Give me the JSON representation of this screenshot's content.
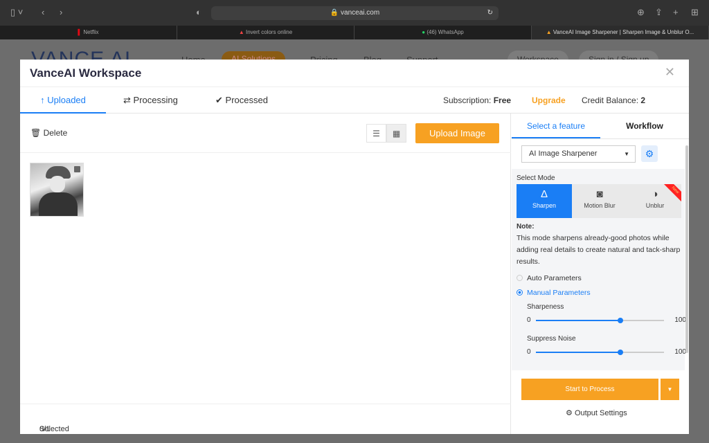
{
  "browser": {
    "url": "vanceai.com",
    "tabs": [
      {
        "label": "Netflix"
      },
      {
        "label": "Invert colors online"
      },
      {
        "label": "(46) WhatsApp"
      },
      {
        "label": "VanceAI Image Sharpener | Sharpen Image & Unblur O..."
      }
    ]
  },
  "site": {
    "logo": "VANCE AI",
    "nav": [
      "Home",
      "AI Solutions",
      "Pricing",
      "Blog",
      "Support"
    ],
    "workspace": "Workspace",
    "signin": "Sign in / Sign up"
  },
  "modal": {
    "title": "VanceAI Workspace",
    "tabs": [
      {
        "label": "Uploaded",
        "icon": "arrow-up"
      },
      {
        "label": "Processing",
        "icon": "refresh"
      },
      {
        "label": "Processed",
        "icon": "check-circle"
      }
    ],
    "subscription_label": "Subscription:",
    "subscription_value": "Free",
    "upgrade": "Upgrade",
    "credit_label": "Credit Balance:",
    "credit_value": "2",
    "delete": "Delete",
    "upload": "Upload Image",
    "selected": "0/1",
    "selected_label": "Selected",
    "side": {
      "tabs": [
        "Select a feature",
        "Workflow"
      ],
      "feature": "AI Image Sharpener",
      "select_mode": "Select Mode",
      "modes": [
        {
          "label": "Sharpen"
        },
        {
          "label": "Motion Blur"
        },
        {
          "label": "Unblur",
          "badge": "New"
        }
      ],
      "note_label": "Note:",
      "note": "This mode sharpens already-good photos while adding real details to create natural and tack-sharp results.",
      "auto": "Auto Parameters",
      "manual": "Manual Parameters",
      "sliders": [
        {
          "label": "Sharpeness",
          "min": "0",
          "max": "100",
          "value": 66
        },
        {
          "label": "Suppress Noise",
          "min": "0",
          "max": "100",
          "value": 66
        }
      ],
      "start": "Start to Process",
      "output": "Output Settings"
    }
  },
  "colors": {
    "accent": "#1a7ef5",
    "orange": "#f7a122"
  }
}
